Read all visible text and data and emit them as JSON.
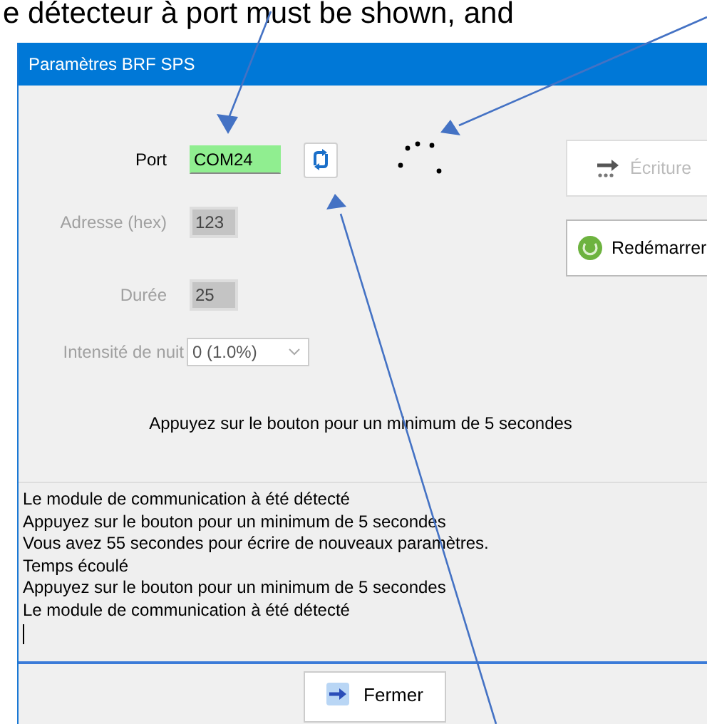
{
  "annotation": {
    "text": "e détecteur à port must be shown, and"
  },
  "window": {
    "title": "Paramètres BRF SPS"
  },
  "fields": [
    {
      "kind": "text",
      "label": "Port",
      "value": "COM24",
      "disabled": false,
      "highlighted": true
    },
    {
      "kind": "text",
      "label": "Adresse (hex)",
      "value": "123",
      "disabled": true,
      "highlighted": false
    },
    {
      "kind": "text",
      "label": "Durée",
      "value": "25",
      "disabled": true,
      "highlighted": false
    },
    {
      "kind": "select",
      "label": "Intensité de nuit",
      "value": "0  (1.0%)",
      "disabled": true,
      "highlighted": false
    }
  ],
  "busy": true,
  "buttons": [
    {
      "kind": "write",
      "label": "Écriture",
      "disabled": true
    },
    {
      "kind": "restart",
      "label": "Redémarrer",
      "disabled": false
    }
  ],
  "prompt": "Appuyez sur le bouton pour un minimum de 5 secondes",
  "log": [
    "Le module de communication à été détecté",
    "Appuyez sur le bouton pour un minimum de 5 secondes",
    "Vous avez 55 secondes pour écrire de nouveaux paramètres.",
    "Temps écoulé",
    "Appuyez sur le bouton pour un minimum de 5 secondes",
    "Le module de communication à été détecté"
  ],
  "close_button": {
    "label": "Fermer"
  }
}
